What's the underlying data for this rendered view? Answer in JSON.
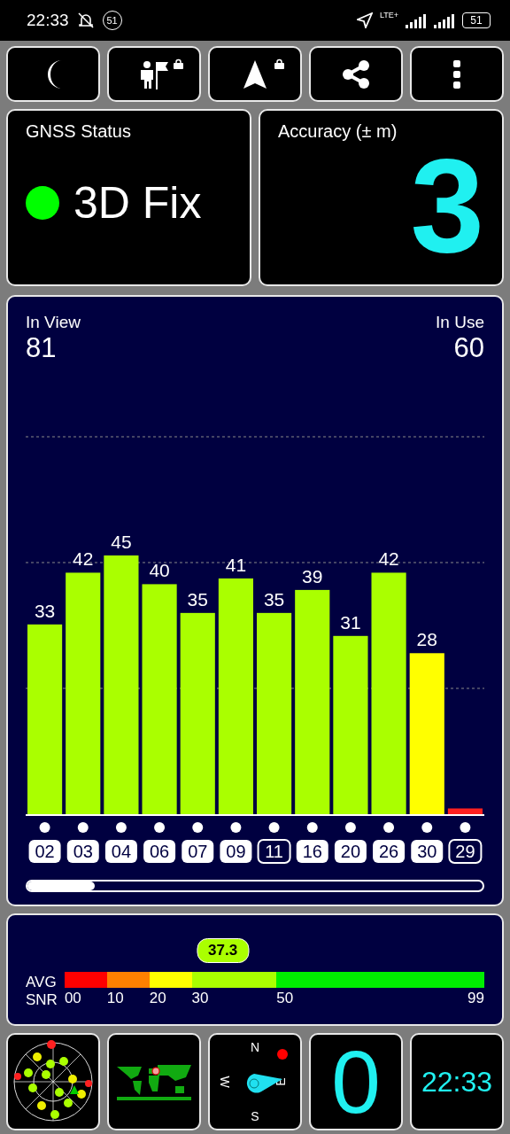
{
  "status_bar": {
    "time": "22:33",
    "notification_count": "51",
    "network": "LTE+",
    "battery": "51"
  },
  "toolbar": [
    {
      "kind": "moon",
      "locked": false
    },
    {
      "kind": "flag",
      "locked": true
    },
    {
      "kind": "arrow",
      "locked": true
    },
    {
      "kind": "share",
      "locked": false
    },
    {
      "kind": "more",
      "locked": false
    }
  ],
  "gnss_status": {
    "title": "GNSS Status",
    "color": "#00ff00",
    "value": "3D Fix"
  },
  "accuracy": {
    "title": "Accuracy (± m)",
    "value": "3"
  },
  "signal_panel": {
    "in_view_label": "In View",
    "in_view": "81",
    "in_use_label": "In Use",
    "in_use": "60",
    "chart_data": {
      "type": "bar",
      "categories": [
        "02",
        "03",
        "04",
        "06",
        "07",
        "09",
        "11",
        "16",
        "20",
        "26",
        "30",
        "29"
      ],
      "values": [
        33,
        42,
        45,
        40,
        35,
        41,
        35,
        39,
        31,
        42,
        28,
        1
      ],
      "value_labels": [
        "33",
        "42",
        "45",
        "40",
        "35",
        "41",
        "35",
        "39",
        "31",
        "42",
        "28",
        null
      ]
    },
    "satellites": [
      {
        "in_use": true
      },
      {
        "in_use": true
      },
      {
        "in_use": true
      },
      {
        "in_use": true
      },
      {
        "in_use": true
      },
      {
        "in_use": true
      },
      {
        "in_use": false
      },
      {
        "in_use": true
      },
      {
        "in_use": true
      },
      {
        "in_use": true
      },
      {
        "in_use": true
      },
      {
        "in_use": false
      }
    ]
  },
  "avg_snr": {
    "label_1": "AVG",
    "label_2": "SNR",
    "value": "37.3",
    "level": 0.377,
    "ticks": [
      "00",
      "10",
      "20",
      "30",
      "50",
      "99"
    ],
    "bands": [
      {
        "color": "#ff0000"
      },
      {
        "color": "#ff8000"
      },
      {
        "color": "#ffff00"
      },
      {
        "color": "#aaff00"
      },
      {
        "color": "#00ee00"
      }
    ]
  },
  "tiles": {
    "compass": {
      "north": "N",
      "west": "W",
      "east": "E",
      "south": "S"
    },
    "speed": "0",
    "clock": "22:33"
  }
}
